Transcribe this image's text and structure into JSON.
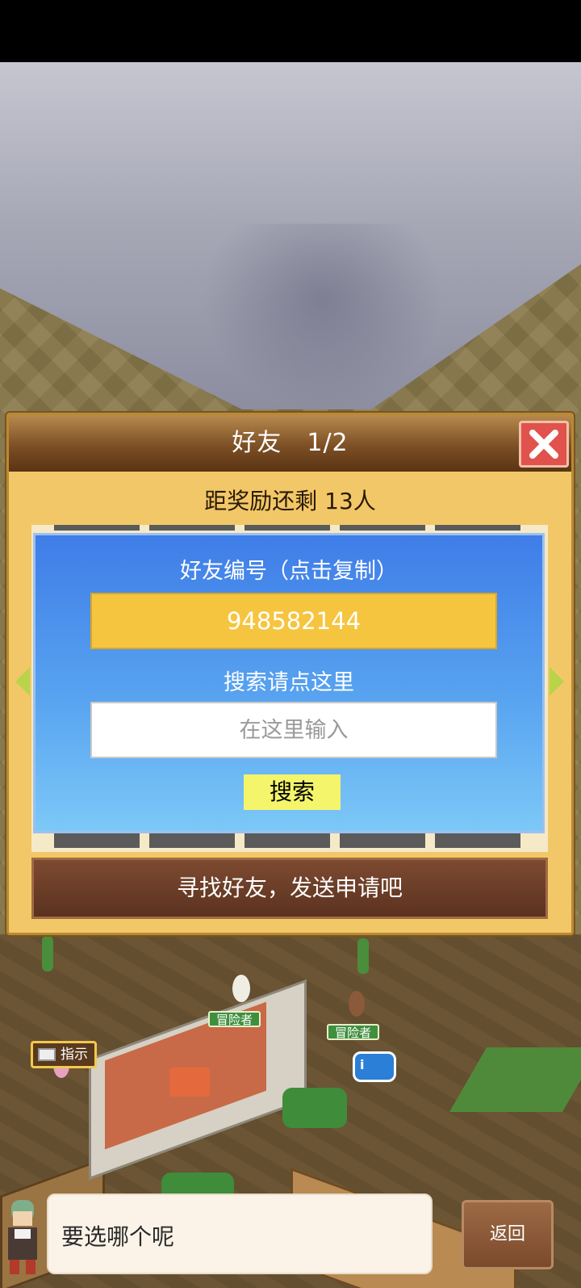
{
  "dialog": {
    "title": "好友　1/2",
    "reward_status": "距奖励还剩 13人",
    "friend_id_label": "好友编号（点击复制）",
    "friend_id": "948582144",
    "search_hint": "搜索请点这里",
    "search_placeholder": "在这里输入",
    "search_button": "搜索",
    "footer_message": "寻找好友，发送申请吧"
  },
  "scene": {
    "adventurer_tags": [
      "冒险者",
      "冒险者"
    ],
    "hint_button": "指示"
  },
  "message": {
    "text": "要选哪个呢",
    "back_button": "返回"
  },
  "colors": {
    "panel_blue": "#3f7de8",
    "id_box_yellow": "#f6c53f",
    "search_button_yellow": "#f4f56a",
    "close_red": "#e0524b",
    "header_brown": "#7c4f25"
  },
  "icons": {
    "close": "close-icon",
    "prev": "arrow-left-icon",
    "next": "arrow-right-icon",
    "hint": "book-icon",
    "info": "info-icon"
  }
}
